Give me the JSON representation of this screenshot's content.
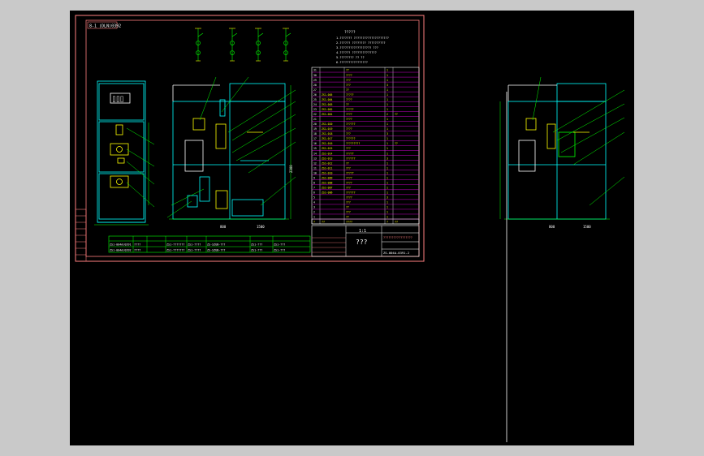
{
  "sheet": {
    "title_tag": "8-1 (DLN)0392",
    "notes_title": "?????",
    "notes": [
      "1.??????? ????????????????????",
      "2.?????? ???????? ??????????",
      "3.?????????????????? ???",
      "4.?????? ??????????????",
      "5.???????? ?? ??",
      "6.????????????????"
    ],
    "title_block": {
      "drawing_name": "???",
      "scale": "1:1",
      "drawing_no": "ZS-004A-0391-2",
      "company": "?????????????????"
    },
    "bom_header": [
      "?",
      "??",
      "????",
      "?",
      "??"
    ],
    "bom_rows": [
      [
        "31",
        "",
        "??",
        "1",
        ""
      ],
      [
        "30",
        "",
        "????",
        "1",
        ""
      ],
      [
        "29",
        "",
        "???",
        "1",
        ""
      ],
      [
        "28",
        "",
        "???",
        "3",
        ""
      ],
      [
        "27",
        "",
        "??",
        "1",
        ""
      ],
      [
        "26",
        "ZS1-005",
        "?????",
        "1",
        ""
      ],
      [
        "25",
        "ZS1-004",
        "????",
        "1",
        ""
      ],
      [
        "24",
        "ZS1-003",
        "??",
        "1",
        ""
      ],
      [
        "23",
        "ZS1-002",
        "?????",
        "1",
        ""
      ],
      [
        "22",
        "ZS1-001",
        "????",
        "2",
        "??"
      ],
      [
        "21",
        "",
        "????",
        "1",
        ""
      ],
      [
        "20",
        "ZS1-020",
        "??????",
        "1",
        ""
      ],
      [
        "19",
        "ZS1-019",
        "????",
        "1",
        ""
      ],
      [
        "18",
        "ZS1-018",
        "???",
        "3",
        ""
      ],
      [
        "17",
        "ZS1-017",
        "??????",
        "1",
        ""
      ],
      [
        "16",
        "ZS1-016",
        "?????????",
        "1",
        "??"
      ],
      [
        "15",
        "ZS1-015",
        "???",
        "1",
        ""
      ],
      [
        "14",
        "ZS1-014",
        "?????",
        "1",
        ""
      ],
      [
        "13",
        "ZS1-013",
        "??????",
        "3",
        ""
      ],
      [
        "12",
        "ZS1-012",
        "??",
        "1",
        ""
      ],
      [
        "11",
        "ZS1-011",
        "???",
        "1",
        ""
      ],
      [
        "10",
        "ZS1-010",
        "?????",
        "1",
        ""
      ],
      [
        "9",
        "ZS1-009",
        "????",
        "1",
        ""
      ],
      [
        "8",
        "ZS1-008",
        "????",
        "1",
        ""
      ],
      [
        "7",
        "ZS1-007",
        "???",
        "1",
        ""
      ],
      [
        "6",
        "ZS1-006",
        "??????",
        "1",
        ""
      ],
      [
        "5",
        "",
        "????",
        "3",
        ""
      ],
      [
        "4",
        "",
        "???",
        "1",
        ""
      ],
      [
        "3",
        "",
        "??",
        "1",
        ""
      ],
      [
        "2",
        "",
        "???",
        "1",
        ""
      ],
      [
        "1",
        "",
        "??",
        "1",
        ""
      ]
    ],
    "bottom_table": [
      [
        "ZS1-004A/0391",
        "????",
        "",
        "ZS1-???????",
        "ZS1-????",
        "ZS-SZUB-???",
        "ZS1-???",
        "ZS1-???"
      ],
      [
        "ZS1-004A/0392",
        "????",
        "",
        "ZS1-???????",
        "ZS1-????",
        "ZS-SZUB-???",
        "ZS1-???",
        "ZS1-???"
      ]
    ],
    "dims": {
      "width_main": "800",
      "height_main": "2300",
      "depth_main": "1500",
      "width_side": "800",
      "depth_side": "1500"
    }
  },
  "colors": {
    "frame": "#ff7f7f",
    "cabinet": "#00ffff",
    "leader": "#00ff00",
    "bom_grid": "#ff00ff",
    "text": "#ffff00",
    "white": "#ffffff",
    "background": "#000000",
    "chrome": "#c9c9c9"
  }
}
